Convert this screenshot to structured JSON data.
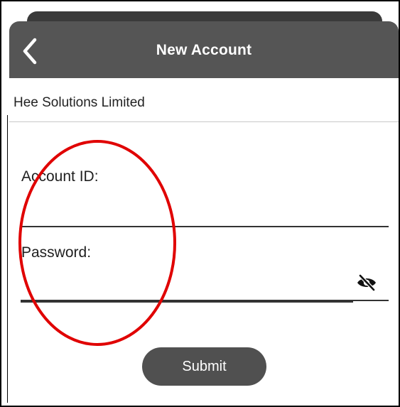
{
  "header": {
    "title": "New Account",
    "back_icon": "chevron-left-icon"
  },
  "organization": {
    "name": "Hee Solutions Limited"
  },
  "form": {
    "account_id_label": "Account ID:",
    "account_id_value": "",
    "password_label": "Password:",
    "password_value": "",
    "visibility_icon": "eye-off-icon",
    "submit_label": "Submit"
  },
  "colors": {
    "header_bg": "#555555",
    "button_bg": "#505050",
    "annotation": "#e00000"
  }
}
